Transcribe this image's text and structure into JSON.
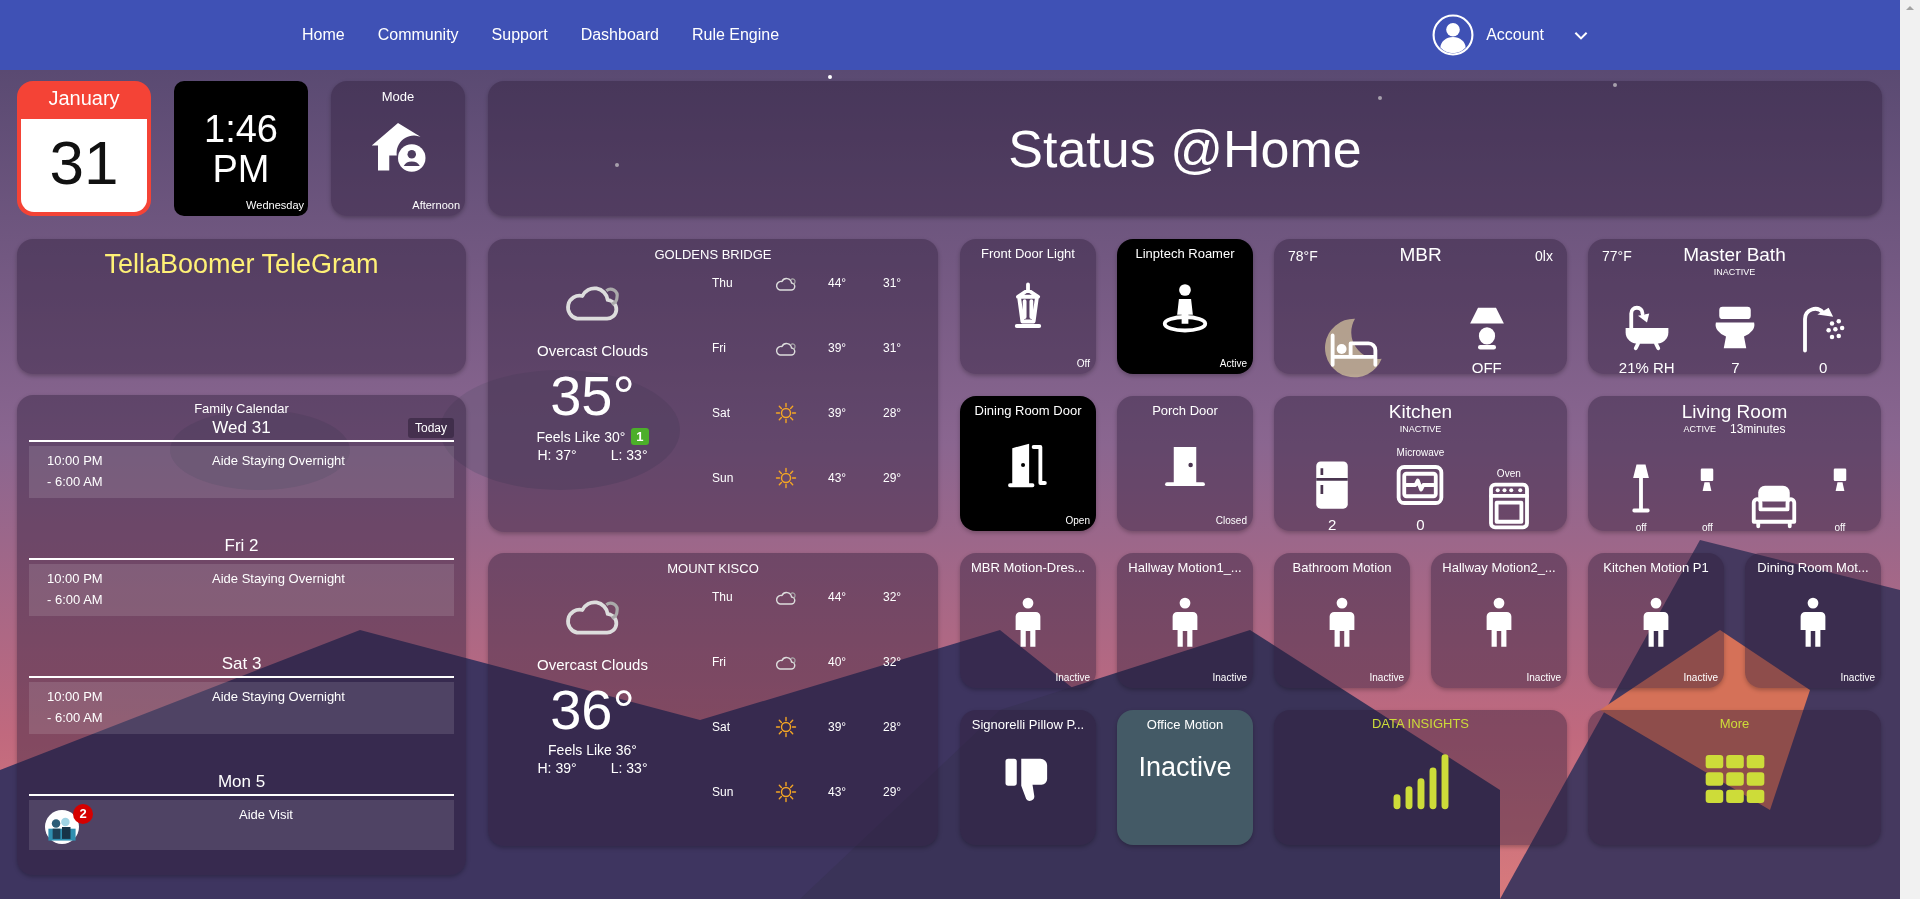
{
  "nav": {
    "links": [
      "Home",
      "Community",
      "Support",
      "Dashboard",
      "Rule Engine"
    ],
    "account": "Account"
  },
  "date_tile": {
    "month": "January",
    "day": "31"
  },
  "clock_tile": {
    "time": "1:46",
    "ampm": "PM",
    "weekday": "Wednesday"
  },
  "mode_tile": {
    "title": "Mode",
    "value": "Afternoon"
  },
  "banner": {
    "title": "Status @Home"
  },
  "telegram": {
    "title": "TellaBoomer TeleGram"
  },
  "family_calendar": {
    "title": "Family Calendar",
    "today_button": "Today",
    "days": [
      {
        "label": "Wed 31",
        "events": [
          {
            "kind": "timed",
            "time_start": "10:00 PM",
            "time_end": "- 6:00 AM",
            "title": "Aide Staying Overnight"
          }
        ]
      },
      {
        "label": "Fri 2",
        "events": [
          {
            "kind": "timed",
            "time_start": "10:00 PM",
            "time_end": "- 6:00 AM",
            "title": "Aide Staying Overnight"
          }
        ]
      },
      {
        "label": "Sat 3",
        "events": [
          {
            "kind": "timed",
            "time_start": "10:00 PM",
            "time_end": "- 6:00 AM",
            "title": "Aide Staying Overnight"
          }
        ]
      },
      {
        "label": "Mon 5",
        "events": [
          {
            "kind": "avatar",
            "badge": "2",
            "title": "Aide Visit"
          }
        ]
      }
    ]
  },
  "weather": [
    {
      "location": "GOLDENS BRIDGE",
      "condition": "Overcast Clouds",
      "temp": "35°",
      "feels_like": "Feels Like 30°",
      "alert_count": "1",
      "high": "H: 37°",
      "low": "L: 33°",
      "forecast": [
        {
          "day": "Thu",
          "kind": "cloudy",
          "high": "44°",
          "low": "31°"
        },
        {
          "day": "Fri",
          "kind": "cloudy",
          "high": "39°",
          "low": "31°"
        },
        {
          "day": "Sat",
          "kind": "sunny",
          "high": "39°",
          "low": "28°"
        },
        {
          "day": "Sun",
          "kind": "sunny",
          "high": "43°",
          "low": "29°"
        }
      ]
    },
    {
      "location": "MOUNT KISCO",
      "condition": "Overcast Clouds",
      "temp": "36°",
      "feels_like": "Feels Like 36°",
      "high": "H: 39°",
      "low": "L: 33°",
      "forecast": [
        {
          "day": "Thu",
          "kind": "cloudy",
          "high": "44°",
          "low": "32°"
        },
        {
          "day": "Fri",
          "kind": "cloudy",
          "high": "40°",
          "low": "32°"
        },
        {
          "day": "Sat",
          "kind": "sunny",
          "high": "39°",
          "low": "28°"
        },
        {
          "day": "Sun",
          "kind": "sunny",
          "high": "43°",
          "low": "29°"
        }
      ]
    }
  ],
  "tiles": [
    {
      "kind": "lantern",
      "title": "Front Door Light",
      "status": "Off",
      "active": false
    },
    {
      "kind": "presence",
      "title": "Linptech Roamer",
      "status": "Active",
      "active": true
    },
    {
      "kind": "room",
      "title": "MBR",
      "temp": "78°F",
      "lux": "0lx",
      "items": [
        {
          "kind": "bed"
        },
        {
          "kind": "table_lamp",
          "value": "OFF"
        }
      ]
    },
    {
      "kind": "room",
      "title": "Master Bath",
      "temp": "77°F",
      "status": "INACTIVE",
      "items": [
        {
          "kind": "bathtub",
          "value": "21%  RH"
        },
        {
          "kind": "toilet",
          "value": "7"
        },
        {
          "kind": "shower",
          "value": "0"
        }
      ]
    },
    {
      "kind": "door_open",
      "title": "Dining Room Door",
      "status": "Open",
      "active": true
    },
    {
      "kind": "door_closed",
      "title": "Porch Door",
      "status": "Closed",
      "active": false
    },
    {
      "kind": "room",
      "title": "Kitchen",
      "status": "INACTIVE",
      "items": [
        {
          "kind": "fridge",
          "value": "2"
        },
        {
          "kind": "microwave",
          "label": "Microwave",
          "value": "0"
        },
        {
          "kind": "oven",
          "label": "Oven"
        }
      ]
    },
    {
      "kind": "room",
      "title": "Living Room",
      "status": "ACTIVE",
      "duration": "13minutes",
      "items": [
        {
          "kind": "floor_lamp",
          "value": "off"
        },
        {
          "kind": "small_lamp",
          "value": "off"
        },
        {
          "kind": "sofa"
        },
        {
          "kind": "small_lamp",
          "value": "off"
        }
      ]
    },
    {
      "kind": "motion",
      "title": "MBR Motion-Dres...",
      "status": "Inactive",
      "active": false
    },
    {
      "kind": "motion",
      "title": "Hallway Motion1_...",
      "status": "Inactive",
      "active": false
    },
    {
      "kind": "motion",
      "title": "Bathroom Motion",
      "status": "Inactive",
      "active": false
    },
    {
      "kind": "motion",
      "title": "Hallway Motion2_...",
      "status": "Inactive",
      "active": false
    },
    {
      "kind": "motion",
      "title": "Kitchen Motion P1",
      "status": "Inactive",
      "active": false
    },
    {
      "kind": "motion",
      "title": "Dining Room Mot...",
      "status": "Inactive",
      "active": false
    },
    {
      "kind": "thumb_down",
      "title": "Signorelli Pillow P...",
      "active": false
    },
    {
      "kind": "big_text",
      "title": "Office Motion",
      "value": "Inactive"
    },
    {
      "kind": "insights",
      "title": "DATA INSIGHTS"
    },
    {
      "kind": "more",
      "title": "More"
    }
  ]
}
